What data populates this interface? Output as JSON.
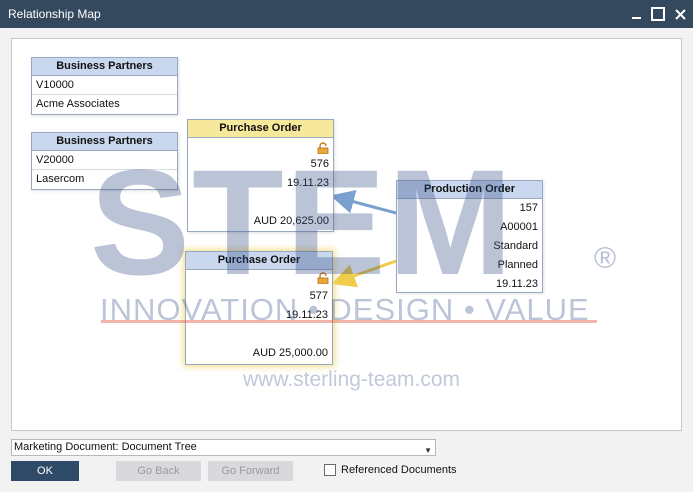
{
  "window": {
    "title": "Relationship Map"
  },
  "nodes": {
    "bp1": {
      "header": "Business Partners",
      "code": "V10000",
      "name": "Acme Associates"
    },
    "bp2": {
      "header": "Business Partners",
      "code": "V20000",
      "name": "Lasercom"
    },
    "po1": {
      "header": "Purchase Order",
      "number": "576",
      "date": "19.11.23",
      "amount": "AUD 20,625.00"
    },
    "po2": {
      "header": "Purchase Order",
      "number": "577",
      "date": "19.11.23",
      "amount": "AUD 25,000.00"
    },
    "prod": {
      "header": "Production Order",
      "number": "157",
      "item": "A00001",
      "type": "Standard",
      "status": "Planned",
      "date": "19.11.23"
    }
  },
  "watermark": {
    "brand": "STEM",
    "registered": "®",
    "tagline": "INNOVATION • DESIGN • VALUE",
    "url": "www.sterling-team.com"
  },
  "footer": {
    "document_select": "Marketing Document: Document Tree",
    "ok_label": "OK",
    "back_label": "Go Back",
    "forward_label": "Go Forward",
    "referenced_label": "Referenced Documents",
    "referenced_checked": false
  },
  "colors": {
    "titlebar": "#34495e",
    "node_header_blue": "#c9d8ef",
    "node_header_yellow": "#f7e99c",
    "link_blue": "#7aa0cf",
    "link_yellow": "#f0cc4a",
    "ok_button": "#2f4a69"
  },
  "icons": {
    "minimize": "minimize-icon",
    "maximize": "maximize-icon",
    "close": "close-icon",
    "lock": "lock-icon",
    "dropdown": "chevron-down-icon"
  }
}
